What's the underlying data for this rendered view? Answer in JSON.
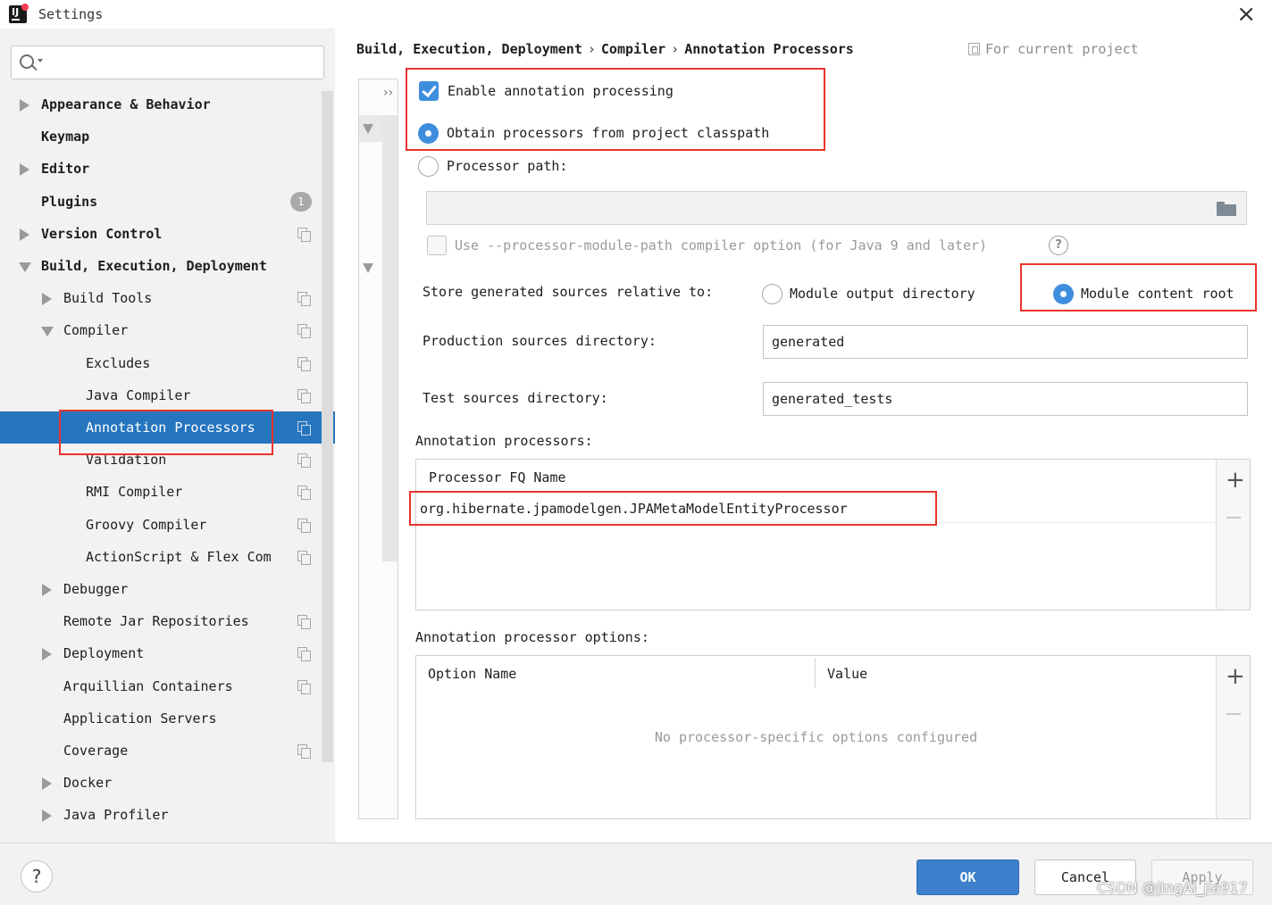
{
  "window": {
    "title": "Settings",
    "close_glyph": "×"
  },
  "sidebar": {
    "search": {
      "value": "",
      "placeholder": ""
    },
    "items": [
      {
        "label": "Appearance & Behavior",
        "indent": 0,
        "bold": true,
        "expander": "collapsed",
        "copy_icon": false
      },
      {
        "label": "Keymap",
        "indent": 0,
        "bold": true,
        "expander": "none",
        "copy_icon": false
      },
      {
        "label": "Editor",
        "indent": 0,
        "bold": true,
        "expander": "collapsed",
        "copy_icon": false
      },
      {
        "label": "Plugins",
        "indent": 0,
        "bold": true,
        "expander": "none",
        "copy_icon": false,
        "badge": "1"
      },
      {
        "label": "Version Control",
        "indent": 0,
        "bold": true,
        "expander": "collapsed",
        "copy_icon": true
      },
      {
        "label": "Build, Execution, Deployment",
        "indent": 0,
        "bold": true,
        "expander": "expanded",
        "copy_icon": false
      },
      {
        "label": "Build Tools",
        "indent": 1,
        "bold": false,
        "expander": "collapsed",
        "copy_icon": true
      },
      {
        "label": "Compiler",
        "indent": 1,
        "bold": false,
        "expander": "expanded",
        "copy_icon": true
      },
      {
        "label": "Excludes",
        "indent": 2,
        "bold": false,
        "expander": "none",
        "copy_icon": true
      },
      {
        "label": "Java Compiler",
        "indent": 2,
        "bold": false,
        "expander": "none",
        "copy_icon": true
      },
      {
        "label": "Annotation Processors",
        "indent": 2,
        "bold": false,
        "expander": "none",
        "copy_icon": true,
        "selected": true
      },
      {
        "label": "Validation",
        "indent": 2,
        "bold": false,
        "expander": "none",
        "copy_icon": true
      },
      {
        "label": "RMI Compiler",
        "indent": 2,
        "bold": false,
        "expander": "none",
        "copy_icon": true
      },
      {
        "label": "Groovy Compiler",
        "indent": 2,
        "bold": false,
        "expander": "none",
        "copy_icon": true
      },
      {
        "label": "ActionScript & Flex Com",
        "indent": 2,
        "bold": false,
        "expander": "none",
        "copy_icon": true
      },
      {
        "label": "Debugger",
        "indent": 1,
        "bold": false,
        "expander": "collapsed",
        "copy_icon": false
      },
      {
        "label": "Remote Jar Repositories",
        "indent": 1,
        "bold": false,
        "expander": "none",
        "copy_icon": true
      },
      {
        "label": "Deployment",
        "indent": 1,
        "bold": false,
        "expander": "collapsed",
        "copy_icon": true
      },
      {
        "label": "Arquillian Containers",
        "indent": 1,
        "bold": false,
        "expander": "none",
        "copy_icon": true
      },
      {
        "label": "Application Servers",
        "indent": 1,
        "bold": false,
        "expander": "none",
        "copy_icon": false
      },
      {
        "label": "Coverage",
        "indent": 1,
        "bold": false,
        "expander": "none",
        "copy_icon": true
      },
      {
        "label": "Docker",
        "indent": 1,
        "bold": false,
        "expander": "collapsed",
        "copy_icon": false
      },
      {
        "label": "Java Profiler",
        "indent": 1,
        "bold": false,
        "expander": "collapsed",
        "copy_icon": false
      }
    ]
  },
  "breadcrumb": {
    "parts": [
      "Build, Execution, Deployment",
      "Compiler",
      "Annotation Processors"
    ],
    "separator": "›",
    "scope": "For current project"
  },
  "gutter": {
    "chevrons": "››"
  },
  "settings": {
    "enable_annotation_processing": {
      "label": "Enable annotation processing",
      "checked": true
    },
    "obtain_from_classpath": {
      "label": "Obtain processors from project classpath",
      "selected": true
    },
    "processor_path": {
      "label": "Processor path:",
      "selected": false,
      "value": ""
    },
    "module_path_option": {
      "label": "Use --processor-module-path compiler option (for Java 9 and later)",
      "checked": false,
      "enabled": false
    },
    "store_generated": {
      "label": "Store generated sources relative to:",
      "options": [
        {
          "label": "Module output directory",
          "selected": false
        },
        {
          "label": "Module content root",
          "selected": true
        }
      ]
    },
    "production_dir": {
      "label": "Production sources directory:",
      "value": "generated"
    },
    "test_dir": {
      "label": "Test sources directory:",
      "value": "generated_tests"
    }
  },
  "processors_table": {
    "title": "Annotation processors:",
    "column": "Processor FQ Name",
    "rows": [
      "org.hibernate.jpamodelgen.JPAMetaModelEntityProcessor"
    ],
    "add": "+",
    "remove": "−"
  },
  "options_table": {
    "title": "Annotation processor options:",
    "columns": [
      "Option Name",
      "Value"
    ],
    "empty_text": "No processor-specific options configured",
    "add": "+"
  },
  "footer": {
    "help": "?",
    "ok": "OK",
    "cancel": "Cancel",
    "apply": "Apply",
    "watermark": "CSDN @JingAi_jia917"
  },
  "colors": {
    "accent": "#3f8ede",
    "selection": "#2675bf",
    "highlight_box": "#e8342e"
  }
}
